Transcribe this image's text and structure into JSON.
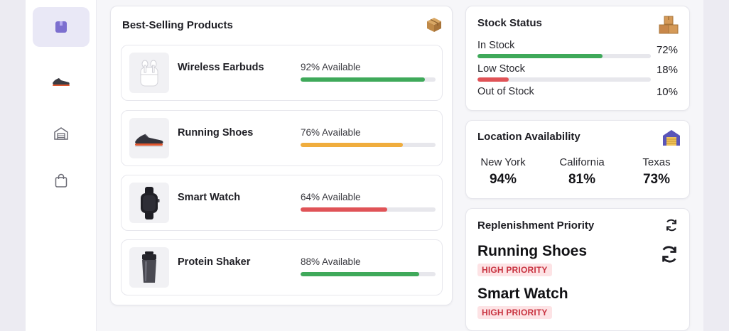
{
  "colors": {
    "accent": "#7c6fcf",
    "green": "#3fa95a",
    "orange": "#f0ad3d",
    "red": "#e05357",
    "badge_bg": "#fde3e5",
    "badge_text": "#c8323f"
  },
  "sidebar": {
    "items": [
      {
        "icon": "box-icon",
        "active": true
      },
      {
        "icon": "shoe-icon",
        "active": false
      },
      {
        "icon": "warehouse-icon",
        "active": false
      },
      {
        "icon": "shopping-bag-icon",
        "active": false
      }
    ]
  },
  "best_selling": {
    "title": "Best-Selling Products",
    "icon": "box-icon",
    "products": [
      {
        "name": "Wireless Earbuds",
        "availability_text": "92% Available",
        "availability": 92,
        "color": "#3fa95a",
        "image": "earbuds-image"
      },
      {
        "name": "Running Shoes",
        "availability_text": "76% Available",
        "availability": 76,
        "color": "#f0ad3d",
        "image": "shoes-image"
      },
      {
        "name": "Smart Watch",
        "availability_text": "64% Available",
        "availability": 64,
        "color": "#e05357",
        "image": "watch-image"
      },
      {
        "name": "Protein Shaker",
        "availability_text": "88% Available",
        "availability": 88,
        "color": "#3fa95a",
        "image": "shaker-image"
      }
    ]
  },
  "stock_status": {
    "title": "Stock Status",
    "icon": "boxes-icon",
    "rows": [
      {
        "label": "In Stock",
        "pct_text": "72%",
        "value": 72,
        "color": "#3fa95a"
      },
      {
        "label": "Low Stock",
        "pct_text": "18%",
        "value": 18,
        "color": "#e05357"
      },
      {
        "label": "Out of Stock",
        "pct_text": "10%",
        "value": 10,
        "color": ""
      }
    ]
  },
  "location": {
    "title": "Location Availability",
    "icon": "warehouse-icon",
    "items": [
      {
        "name": "New York",
        "value": "94%"
      },
      {
        "name": "California",
        "value": "81%"
      },
      {
        "name": "Texas",
        "value": "73%"
      }
    ]
  },
  "replenishment": {
    "title": "Replenishment Priority",
    "icon": "refresh-icon",
    "items": [
      {
        "name": "Running Shoes",
        "badge": "HIGH PRIORITY"
      },
      {
        "name": "Smart Watch",
        "badge": "HIGH PRIORITY"
      }
    ]
  }
}
